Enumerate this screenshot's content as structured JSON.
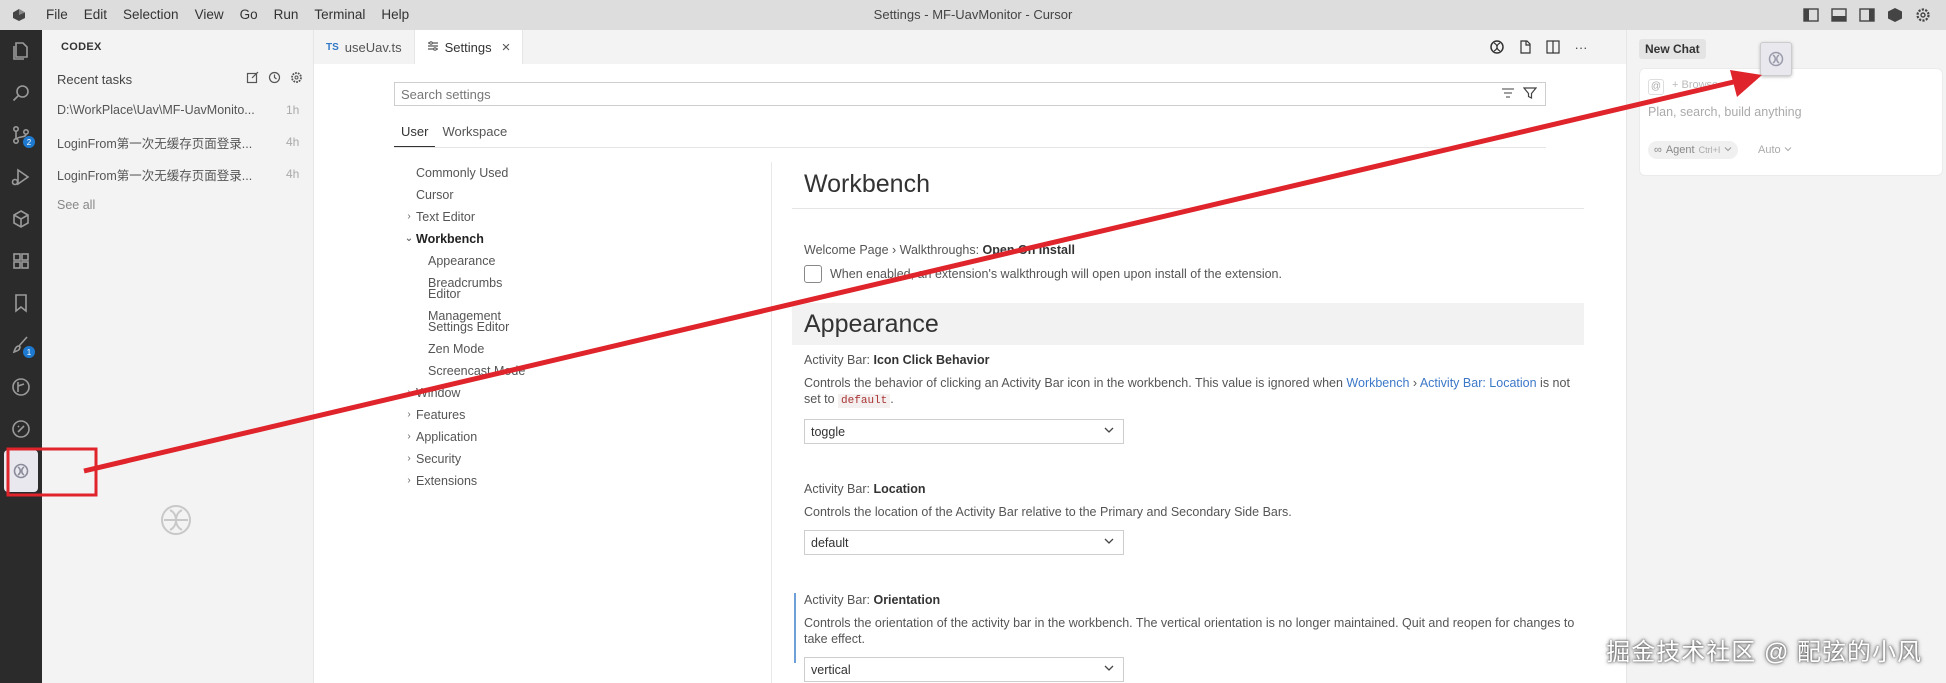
{
  "titlebar": {
    "menu": [
      "File",
      "Edit",
      "Selection",
      "View",
      "Go",
      "Run",
      "Terminal",
      "Help"
    ],
    "title": "Settings - MF-UavMonitor - Cursor"
  },
  "activitybar": {
    "icons": [
      "explorer-icon",
      "search-icon",
      "source-control-icon",
      "run-debug-icon",
      "cube-icon",
      "extensions-icon",
      "bookmark-icon",
      "brush-icon",
      "git-graph-icon",
      "test-icon",
      "codex-icon"
    ],
    "badges": {
      "source_control": "2",
      "brush": "1"
    }
  },
  "codex": {
    "header": "CODEX",
    "recent_label": "Recent tasks",
    "tasks": [
      {
        "title": "D:\\WorkPlace\\Uav\\MF-UavMonito...",
        "time": "1h"
      },
      {
        "title": "LoginFrom第一次无缓存页面登录...",
        "time": "4h"
      },
      {
        "title": "LoginFrom第一次无缓存页面登录...",
        "time": "4h"
      }
    ],
    "see_all": "See all"
  },
  "tabs": [
    {
      "label": "useUav.ts",
      "badge": "TS"
    },
    {
      "label": "Settings"
    }
  ],
  "settings": {
    "search_placeholder": "Search settings",
    "scopes": [
      "User",
      "Workspace"
    ],
    "toc": [
      {
        "label": "Commonly Used",
        "level": 1,
        "chevron": ""
      },
      {
        "label": "Cursor",
        "level": 1,
        "chevron": ""
      },
      {
        "label": "Text Editor",
        "level": 1,
        "chevron": "right"
      },
      {
        "label": "Workbench",
        "level": 1,
        "chevron": "down",
        "bold": true
      },
      {
        "label": "Appearance",
        "level": 2
      },
      {
        "label": "Breadcrumbs",
        "level": 2
      },
      {
        "label": "Editor Management",
        "level": 2
      },
      {
        "label": "Settings Editor",
        "level": 2
      },
      {
        "label": "Zen Mode",
        "level": 2
      },
      {
        "label": "Screencast Mode",
        "level": 2
      },
      {
        "label": "Window",
        "level": 1,
        "chevron": "right"
      },
      {
        "label": "Features",
        "level": 1,
        "chevron": "right"
      },
      {
        "label": "Application",
        "level": 1,
        "chevron": "right"
      },
      {
        "label": "Security",
        "level": 1,
        "chevron": "right"
      },
      {
        "label": "Extensions",
        "level": 1,
        "chevron": "right"
      }
    ],
    "section_title": "Workbench",
    "welcome": {
      "category": "Welcome Page › Walkthroughs: ",
      "name": "Open On Install",
      "desc": "When enabled, an extension's walkthrough will open upon install of the extension."
    },
    "subsection_title": "Appearance",
    "icon_click": {
      "category": "Activity Bar: ",
      "name": "Icon Click Behavior",
      "desc_pre": "Controls the behavior of clicking an Activity Bar icon in the workbench. This value is ignored when ",
      "link1": "Workbench",
      "sep": " › ",
      "link2": "Activity Bar: Location",
      "desc_mid": " is not set to ",
      "code": "default",
      "desc_post": ".",
      "value": "toggle"
    },
    "location": {
      "category": "Activity Bar: ",
      "name": "Location",
      "desc": "Controls the location of the Activity Bar relative to the Primary and Secondary Side Bars.",
      "value": "default"
    },
    "orientation": {
      "category": "Activity Bar: ",
      "name": "Orientation",
      "desc": "Controls the orientation of the activity bar in the workbench. The vertical orientation is no longer maintained. Quit and reopen for changes to take effect.",
      "value": "vertical"
    }
  },
  "chat": {
    "tab_label": "New Chat",
    "context_hint": "+ Browse",
    "placeholder": "Plan, search, build anything",
    "agent_label": "Agent",
    "agent_shortcut": "Ctrl+I",
    "auto_label": "Auto"
  },
  "annotation": {
    "color": "#e0242b",
    "watermark": "掘金技术社区 @ 配弦的小风"
  }
}
